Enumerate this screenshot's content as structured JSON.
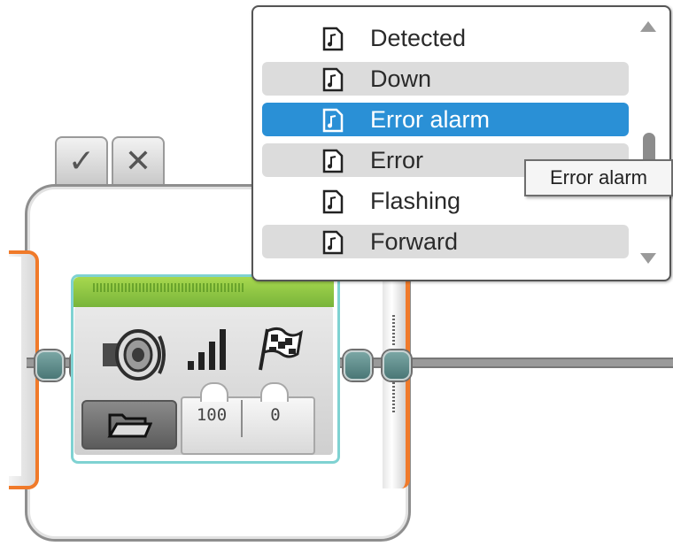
{
  "buttons": {
    "confirm_glyph": "✓",
    "cancel_glyph": "✕"
  },
  "sound_block": {
    "icons": [
      "speaker-icon",
      "volume-icon",
      "finish-flag-icon",
      "folder-icon"
    ],
    "params": {
      "volume": "100",
      "play_type": "0"
    },
    "header_color": "#8cc63f",
    "accent_color": "#7fd2d2"
  },
  "loop": {
    "accent_color": "#f07a2a"
  },
  "dropdown": {
    "items": [
      {
        "label": "Detected",
        "state": "normal"
      },
      {
        "label": "Down",
        "state": "alt"
      },
      {
        "label": "Error alarm",
        "state": "selected"
      },
      {
        "label": "Error",
        "state": "alt"
      },
      {
        "label": "Flashing",
        "state": "normal"
      },
      {
        "label": "Forward",
        "state": "alt"
      }
    ],
    "selected_color": "#2a90d6"
  },
  "tooltip": {
    "text": "Error alarm"
  }
}
